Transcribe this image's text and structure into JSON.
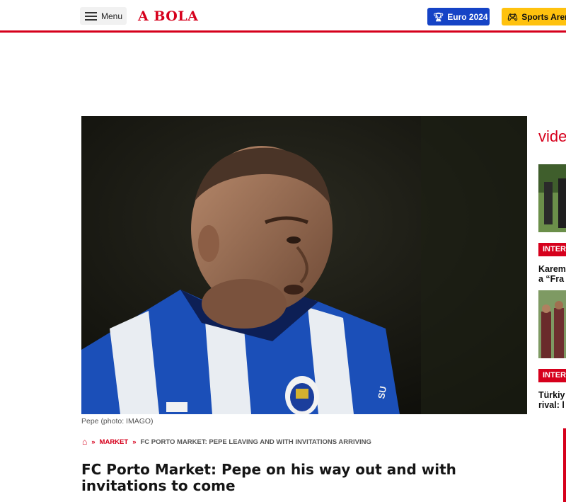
{
  "header": {
    "menu_label": "Menu",
    "logo_text": "A BOLA",
    "euro_label": "Euro 2024",
    "sports_label": "Sports Arena",
    "accent_color": "#d6001c",
    "euro_color": "#1543c6",
    "sports_color": "#ffc20e"
  },
  "hero": {
    "caption": "Pepe (photo: IMAGO)"
  },
  "breadcrumb": {
    "sep": "»",
    "section": "MARKET",
    "current": "FC PORTO MARKET: PEPE LEAVING AND WITH INVITATIONS ARRIVING"
  },
  "article": {
    "title": "FC Porto Market: Pepe on his way out and with invitations to come"
  },
  "sidebar": {
    "heading": "vide",
    "items": [
      {
        "tag": "INTER",
        "title_line1": "Karem",
        "title_line2": "a “Fra"
      },
      {
        "tag": "INTER",
        "title_line1": "Türkiy",
        "title_line2": "rival: l"
      }
    ]
  }
}
